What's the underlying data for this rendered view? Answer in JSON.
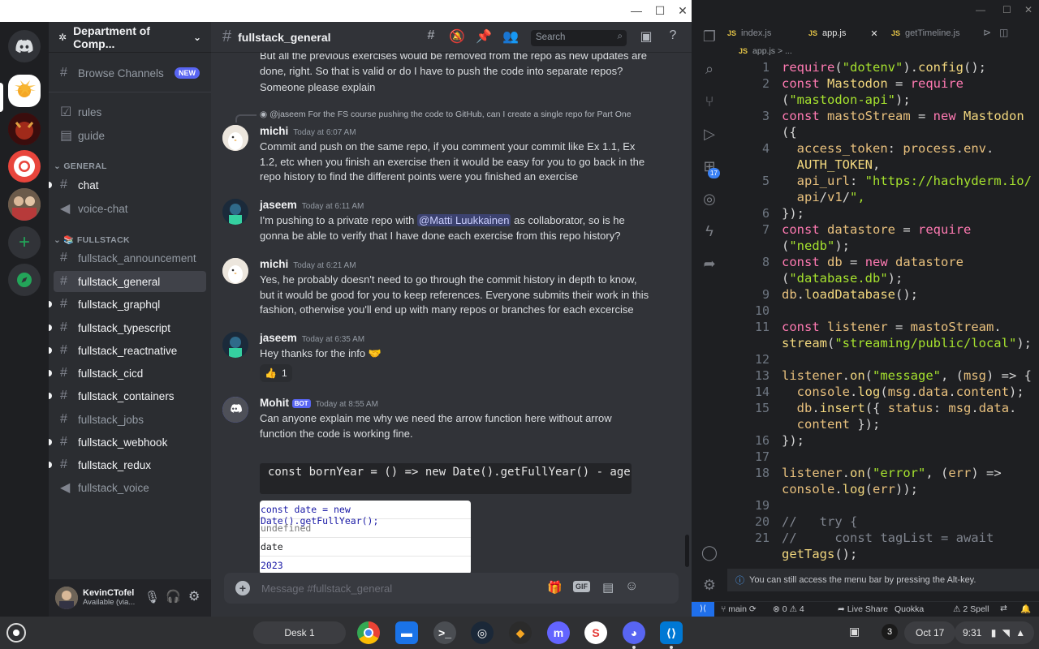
{
  "discord": {
    "guild_name": "Department of Comp...",
    "browse_channels": "Browse Channels",
    "new_badge": "NEW",
    "channels_top": [
      {
        "name": "rules",
        "icon": "rules-icon"
      },
      {
        "name": "guide",
        "icon": "guide-icon"
      }
    ],
    "general_category": "GENERAL",
    "general_channels": [
      {
        "name": "chat",
        "type": "text"
      },
      {
        "name": "voice-chat",
        "type": "voice"
      }
    ],
    "fullstack_category": "📚 FULLSTACK",
    "fullstack_channels": [
      {
        "name": "fullstack_announcement"
      },
      {
        "name": "fullstack_general"
      },
      {
        "name": "fullstack_graphql"
      },
      {
        "name": "fullstack_typescript"
      },
      {
        "name": "fullstack_reactnative"
      },
      {
        "name": "fullstack_cicd"
      },
      {
        "name": "fullstack_containers"
      },
      {
        "name": "fullstack_jobs"
      },
      {
        "name": "fullstack_webhook"
      },
      {
        "name": "fullstack_redux"
      },
      {
        "name": "fullstack_voice"
      }
    ],
    "user": {
      "name": "KevinCTofel",
      "status": "Available (via..."
    },
    "channel_title": "fullstack_general",
    "search_placeholder": "Search",
    "top_text": "But all the previous exercises would be removed from the repo as new updates are done, right. So that is valid or do I have to push the code into separate repos?",
    "top_text_2": "Someone please explain",
    "reply_preview": "@jaseem For the FS course pushing the code to GitHub, can I create a single repo for Part One",
    "messages": [
      {
        "author": "michi",
        "time": "Today at 6:07 AM",
        "text": "Commit and push on the same repo, if you comment your commit like Ex 1.1, Ex 1.2, etc when you finish an exercise then it would be easy for you to go back in the repo history to find the different points were you finished an exercise"
      },
      {
        "author": "jaseem",
        "time": "Today at 6:11 AM",
        "text_before": "I'm pushing to a private repo with",
        "mention": "@Matti Luukkainen",
        "text_after": "as collaborator, so is he gonna be able to verify that I have done each exercise from this repo history?"
      },
      {
        "author": "michi",
        "time": "Today at 6:21 AM",
        "text": "Yes, he probably doesn't need to go through the commit history in depth to know, but it would be good for you to keep references. Everyone submits their work in this fashion, otherwise you'll end up with many repos or branches for each excercise"
      },
      {
        "author": "jaseem",
        "time": "Today at 6:35 AM",
        "text": "Hey thanks for the info 🤝",
        "reaction": "👍",
        "reaction_count": "1"
      },
      {
        "author": "Mohit",
        "badge": "BOT",
        "time": "Today at 8:55 AM",
        "text": "Can anyone explain me why we need the arrow function here without arrow function the code is working fine."
      }
    ],
    "code_snippet": "const bornYear = () => new Date().getFullYear() - age",
    "console_lines": [
      "const date = new Date().getFullYear();",
      "undefined",
      "date",
      "2023"
    ],
    "composer_placeholder": "Message #fullstack_general"
  },
  "vscode": {
    "tabs": [
      "index.js",
      "app.js",
      "getTimeline.js"
    ],
    "breadcrumb": "app.js > ...",
    "badge_count": "17",
    "lines": [
      {
        "n": "1",
        "code": "require(\"dotenv\").config();"
      },
      {
        "n": "2",
        "code": "const Mastodon = require"
      },
      {
        "n": "",
        "code": "(\"mastodon-api\");"
      },
      {
        "n": "3",
        "code": "const mastoStream = new Mastodon"
      },
      {
        "n": "",
        "code": "({"
      },
      {
        "n": "4",
        "code": "  access_token: process.env."
      },
      {
        "n": "",
        "code": "  AUTH_TOKEN,"
      },
      {
        "n": "5",
        "code": "  api_url: \"https://hachyderm.io/"
      },
      {
        "n": "",
        "code": "  api/v1/\","
      },
      {
        "n": "6",
        "code": "});"
      },
      {
        "n": "7",
        "code": "const datastore = require"
      },
      {
        "n": "",
        "code": "(\"nedb\");"
      },
      {
        "n": "8",
        "code": "const db = new datastore"
      },
      {
        "n": "",
        "code": "(\"database.db\");"
      },
      {
        "n": "9",
        "code": "db.loadDatabase();"
      },
      {
        "n": "10",
        "code": ""
      },
      {
        "n": "11",
        "code": "const listener = mastoStream."
      },
      {
        "n": "",
        "code": "stream(\"streaming/public/local\");"
      },
      {
        "n": "12",
        "code": ""
      },
      {
        "n": "13",
        "code": "listener.on(\"message\", (msg) => {"
      },
      {
        "n": "14",
        "code": "  console.log(msg.data.content);"
      },
      {
        "n": "15",
        "code": "  db.insert({ status: msg.data."
      },
      {
        "n": "",
        "code": "  content });"
      },
      {
        "n": "16",
        "code": "});"
      },
      {
        "n": "17",
        "code": ""
      },
      {
        "n": "18",
        "code": "listener.on(\"error\", (err) =>"
      },
      {
        "n": "",
        "code": "console.log(err));"
      },
      {
        "n": "19",
        "code": ""
      },
      {
        "n": "20",
        "code": "//   try {"
      },
      {
        "n": "21",
        "code": "//     const tagList = await"
      },
      {
        "n": "",
        "code": "getTags();"
      }
    ],
    "toast": "You can still access the menu bar by pressing the Alt-key.",
    "status": {
      "branch": "main",
      "errors": "0",
      "warnings": "4",
      "live_share": "Live Share",
      "quokka": "Quokka",
      "spell": "2 Spell"
    }
  },
  "shelf": {
    "desk": "Desk 1",
    "notifications": "3",
    "date": "Oct 17",
    "time": "9:31"
  },
  "colors": {
    "discord_bg": "#313338",
    "blurple": "#5865f2",
    "vscode_bg": "#1e1f22",
    "shelf_bg": "#2f3033"
  }
}
